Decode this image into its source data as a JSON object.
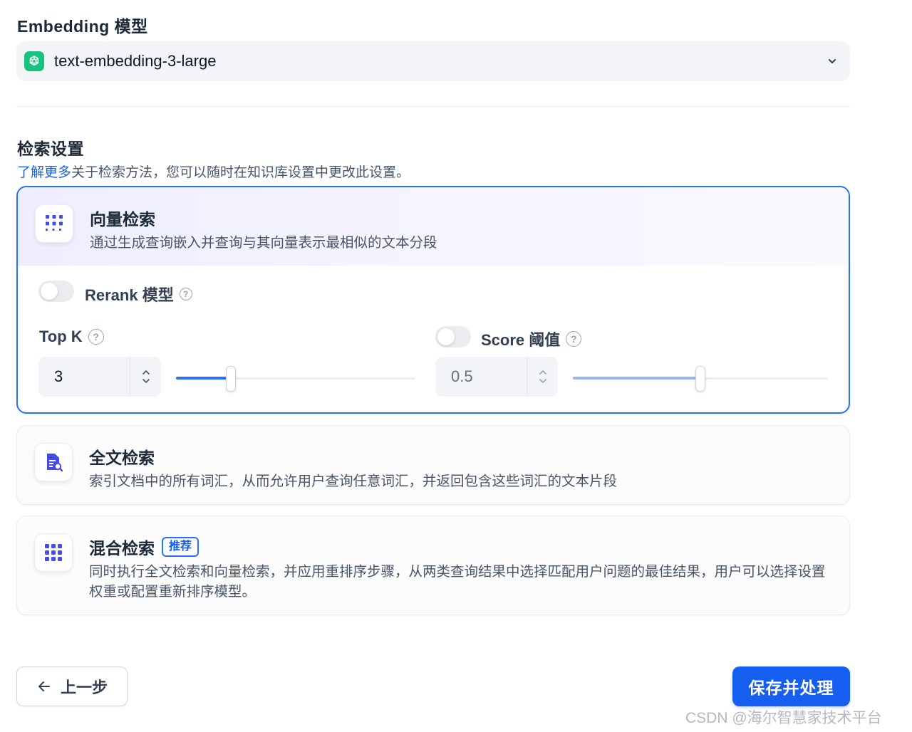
{
  "embedding": {
    "title": "Embedding 模型",
    "selected_model": "text-embedding-3-large",
    "logo_icon": "openai-logo-icon",
    "dropdown_icon": "chevron-down-icon"
  },
  "retrieval": {
    "title": "检索设置",
    "learn_more": "了解更多",
    "description": "关于检索方法，您可以随时在知识库设置中更改此设置。",
    "methods": [
      {
        "title": "向量检索",
        "description": "通过生成查询嵌入并查询与其向量表示最相似的文本分段",
        "icon": "vector-grid-icon"
      },
      {
        "title": "全文检索",
        "description": "索引文档中的所有词汇，从而允许用户查询任意词汇，并返回包含这些词汇的文本片段",
        "icon": "document-search-icon"
      },
      {
        "title": "混合检索",
        "badge": "推荐",
        "description": "同时执行全文检索和向量检索，并应用重排序步骤，从两类查询结果中选择匹配用户问题的最佳结果，用户可以选择设置权重或配置重新排序模型。",
        "icon": "hybrid-grid-icon"
      }
    ],
    "rerank": {
      "label": "Rerank 模型",
      "enabled": false
    },
    "top_k": {
      "label": "Top K",
      "value": "3",
      "slider_fraction": 0.23
    },
    "score": {
      "label": "Score 阈值",
      "value": "0.5",
      "enabled": false,
      "slider_fraction": 0.5
    }
  },
  "footer": {
    "back_label": "上一步",
    "save_label": "保存并处理",
    "watermark": "CSDN @海尔智慧家技术平台"
  },
  "colors": {
    "accent": "#155eef",
    "active_border": "#2970ff",
    "icon_purple": "#444ce7",
    "openai_green": "#19c37d"
  }
}
